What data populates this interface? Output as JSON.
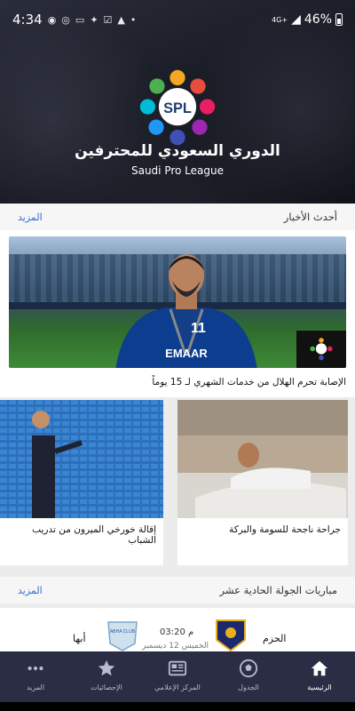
{
  "status_bar": {
    "time": "4:34",
    "network": "4G+",
    "battery": "46%",
    "icons": [
      "whatsapp-icon",
      "location-icon",
      "sim-icon",
      "twitter-icon",
      "check-icon",
      "drive-icon",
      "dot-icon"
    ]
  },
  "header": {
    "logo_text": "SPL",
    "title_ar": "الدوري السعودي للمحترفين",
    "title_en": "Saudi Pro League"
  },
  "news_section": {
    "title": "أحدث الأخبار",
    "more": "المزيد",
    "main": {
      "caption": "الإصابة تحرم الهلال من خدمات الشهري لـ 15 يوماً",
      "jersey_number": "11",
      "sponsor": "EMAAR"
    },
    "cards": [
      {
        "caption": "إقالة خورخي الميرون من تدريب الشباب"
      },
      {
        "caption": "جراحة ناجحة للسومة والبركة"
      }
    ]
  },
  "matches_section": {
    "title": "مباريات الجولة الحادية عشر",
    "more": "المزيد",
    "match": {
      "home": "الحزم",
      "away": "أبها",
      "time": "03:20 م",
      "date": "الخميس 12 ديسمبر",
      "away_crest_text": "ABHA CLUB"
    }
  },
  "bottom_nav": {
    "items": [
      {
        "label": "المزيد",
        "icon": "more-dots-icon"
      },
      {
        "label": "الإحصائيات",
        "icon": "star-icon"
      },
      {
        "label": "المركز الإعلامي",
        "icon": "news-icon"
      },
      {
        "label": "الجدول",
        "icon": "ball-icon"
      },
      {
        "label": "الرئيسية",
        "icon": "home-icon"
      }
    ],
    "active_index": 4
  },
  "colors": {
    "accent": "#2f6fd6",
    "nav_bg": "#2a2d44"
  }
}
